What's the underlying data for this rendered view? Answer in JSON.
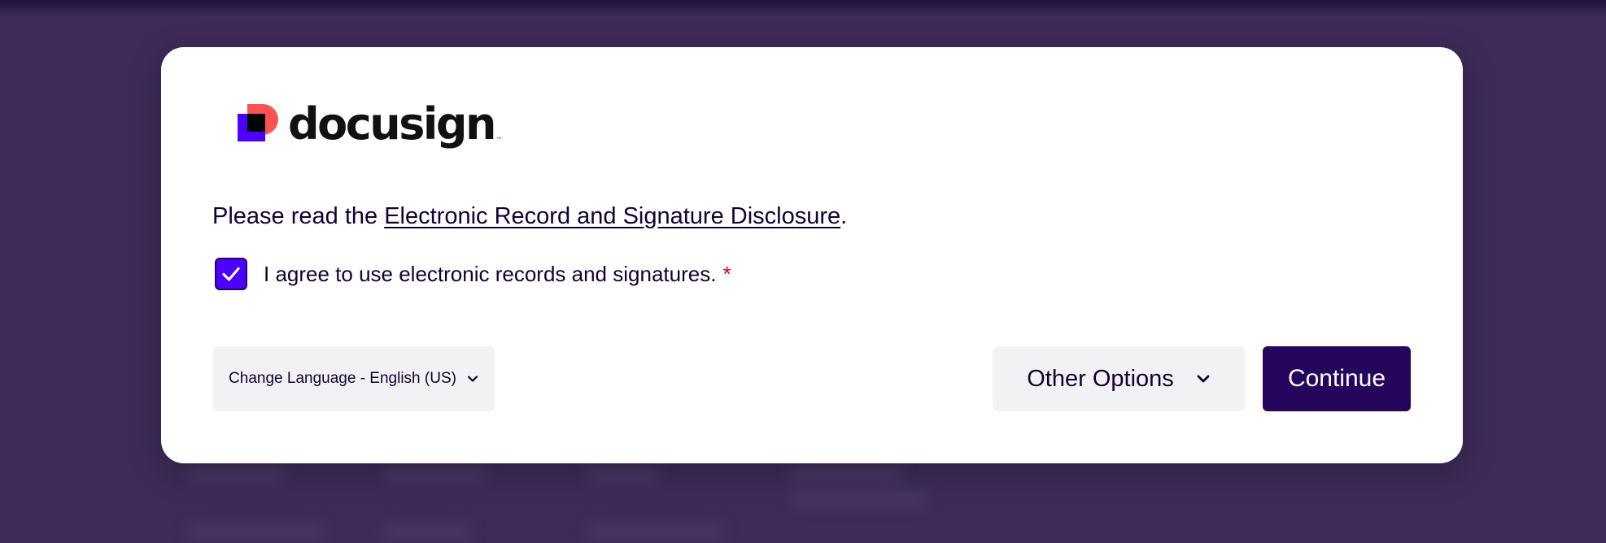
{
  "logo": {
    "text": "docusign",
    "tm": "™",
    "colors": {
      "red": "#ff5252",
      "purple": "#4c00ff",
      "black": "#000000"
    }
  },
  "disclosure": {
    "prefix": "Please read the ",
    "link_text": "Electronic Record and Signature Disclosure",
    "suffix": "."
  },
  "agreement": {
    "checked": true,
    "label": "I agree to use electronic records and signatures.",
    "required_mark": "*",
    "checkbox_icon": "checkmark-icon"
  },
  "language": {
    "label": "Change Language - English (US)",
    "icon": "chevron-down-icon"
  },
  "actions": {
    "other_options_label": "Other Options",
    "other_options_icon": "chevron-down-icon",
    "continue_label": "Continue"
  },
  "colors": {
    "background": "#3e2b59",
    "primary": "#26065d",
    "accent": "#4c00ff",
    "required": "#c8003c",
    "secondary_button": "#f2f2f4",
    "text": "#130032"
  }
}
